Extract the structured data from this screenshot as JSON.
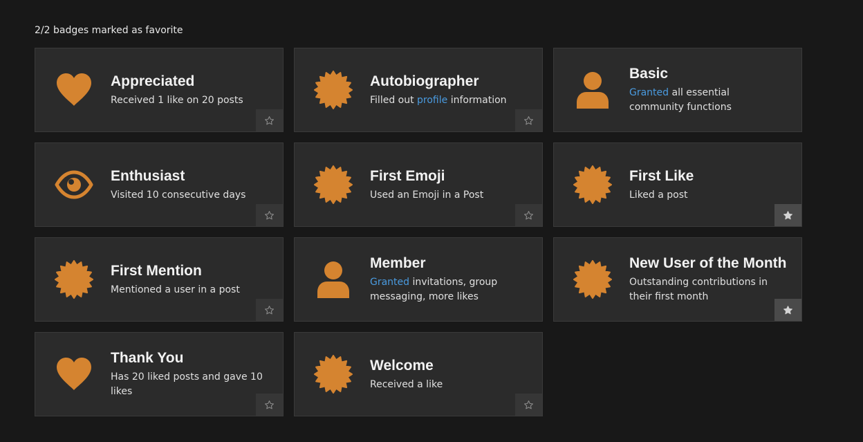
{
  "summary": "2/2 badges marked as favorite",
  "colors": {
    "icon": "#d58430",
    "link": "#4a9be0",
    "card_bg": "#2b2b2b",
    "page_bg": "#181818"
  },
  "badges": [
    {
      "name": "Appreciated",
      "icon": "heart-icon",
      "desc": "Received 1 like on 20 posts",
      "favoritable": true,
      "favorite": false
    },
    {
      "name": "Autobiographer",
      "icon": "badge-seal-icon",
      "desc_before": "Filled out ",
      "desc_link": "profile",
      "desc_after": " information",
      "favoritable": true,
      "favorite": false
    },
    {
      "name": "Basic",
      "icon": "user-icon",
      "desc_link": "Granted",
      "desc_after": " all essential community functions",
      "favoritable": false,
      "favorite": false
    },
    {
      "name": "Enthusiast",
      "icon": "eye-icon",
      "desc": "Visited 10 consecutive days",
      "favoritable": true,
      "favorite": false
    },
    {
      "name": "First Emoji",
      "icon": "badge-seal-icon",
      "desc": "Used an Emoji in a Post",
      "favoritable": true,
      "favorite": false
    },
    {
      "name": "First Like",
      "icon": "badge-seal-icon",
      "desc": "Liked a post",
      "favoritable": true,
      "favorite": true
    },
    {
      "name": "First Mention",
      "icon": "badge-seal-icon",
      "desc": "Mentioned a user in a post",
      "favoritable": true,
      "favorite": false
    },
    {
      "name": "Member",
      "icon": "user-icon",
      "desc_link": "Granted",
      "desc_after": " invitations, group messaging, more likes",
      "favoritable": false,
      "favorite": false
    },
    {
      "name": "New User of the Month",
      "icon": "badge-seal-icon",
      "desc": "Outstanding contributions in their first month",
      "favoritable": true,
      "favorite": true
    },
    {
      "name": "Thank You",
      "icon": "heart-icon",
      "desc": "Has 20 liked posts and gave 10 likes",
      "favoritable": true,
      "favorite": false
    },
    {
      "name": "Welcome",
      "icon": "badge-seal-icon",
      "desc": "Received a like",
      "favoritable": true,
      "favorite": false
    }
  ]
}
